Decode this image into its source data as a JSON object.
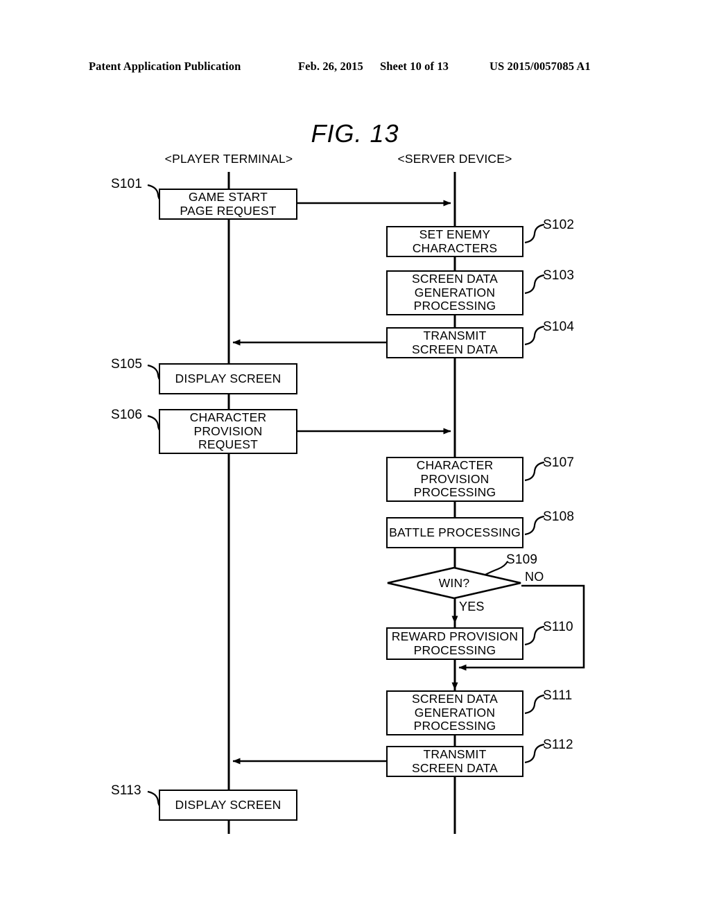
{
  "header": {
    "publication": "Patent Application Publication",
    "date": "Feb. 26, 2015",
    "sheet": "Sheet 10 of 13",
    "number": "US 2015/0057085 A1"
  },
  "figure": {
    "title": "FIG. 13",
    "lanes": {
      "left": "<PLAYER TERMINAL>",
      "right": "<SERVER DEVICE>"
    }
  },
  "flowchart": {
    "nodes": [
      {
        "id": "S101",
        "ref": "S101",
        "lane": "left",
        "shape": "process",
        "label": "GAME START\nPAGE REQUEST"
      },
      {
        "id": "S102",
        "ref": "S102",
        "lane": "right",
        "shape": "process",
        "label": "SET ENEMY\nCHARACTERS"
      },
      {
        "id": "S103",
        "ref": "S103",
        "lane": "right",
        "shape": "process",
        "label": "SCREEN DATA\nGENERATION\nPROCESSING"
      },
      {
        "id": "S104",
        "ref": "S104",
        "lane": "right",
        "shape": "process",
        "label": "TRANSMIT\nSCREEN DATA"
      },
      {
        "id": "S105",
        "ref": "S105",
        "lane": "left",
        "shape": "process",
        "label": "DISPLAY SCREEN"
      },
      {
        "id": "S106",
        "ref": "S106",
        "lane": "left",
        "shape": "process",
        "label": "CHARACTER\nPROVISION\nREQUEST"
      },
      {
        "id": "S107",
        "ref": "S107",
        "lane": "right",
        "shape": "process",
        "label": "CHARACTER\nPROVISION\nPROCESSING"
      },
      {
        "id": "S108",
        "ref": "S108",
        "lane": "right",
        "shape": "process",
        "label": "BATTLE PROCESSING"
      },
      {
        "id": "S109",
        "ref": "S109",
        "lane": "right",
        "shape": "decision",
        "label": "WIN?"
      },
      {
        "id": "S110",
        "ref": "S110",
        "lane": "right",
        "shape": "process",
        "label": "REWARD PROVISION\nPROCESSING"
      },
      {
        "id": "S111",
        "ref": "S111",
        "lane": "right",
        "shape": "process",
        "label": "SCREEN DATA\nGENERATION\nPROCESSING"
      },
      {
        "id": "S112",
        "ref": "S112",
        "lane": "right",
        "shape": "process",
        "label": "TRANSMIT\nSCREEN DATA"
      },
      {
        "id": "S113",
        "ref": "S113",
        "lane": "left",
        "shape": "process",
        "label": "DISPLAY SCREEN"
      }
    ],
    "branches": {
      "yes": "YES",
      "no": "NO"
    }
  }
}
